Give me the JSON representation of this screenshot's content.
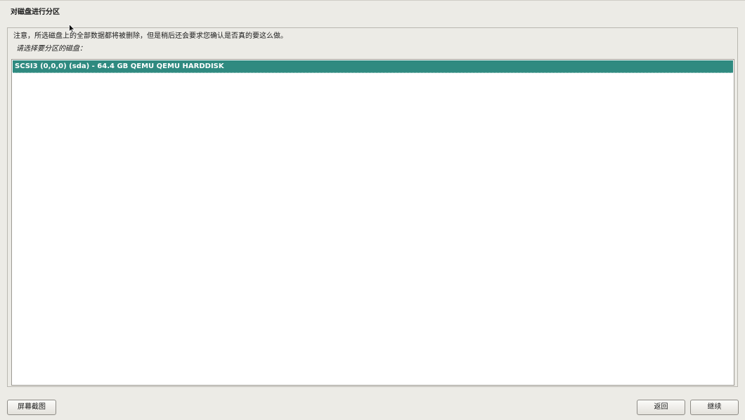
{
  "page": {
    "title": "对磁盘进行分区",
    "warning": "注意，所选磁盘上的全部数据都将被删除，但是稍后还会要求您确认是否真的要这么做。",
    "prompt": "请选择要分区的磁盘："
  },
  "disks": {
    "items": [
      {
        "label": "SCSI3 (0,0,0) (sda) - 64.4 GB QEMU QEMU HARDDISK",
        "selected": true
      }
    ]
  },
  "buttons": {
    "screenshot": "屏幕截图",
    "back": "返回",
    "continue": "继续"
  },
  "colors": {
    "background": "#ecebe6",
    "selection": "#2f8a80",
    "list_background": "#ffffff"
  },
  "icons": {
    "cursor": "mouse-pointer-icon"
  }
}
